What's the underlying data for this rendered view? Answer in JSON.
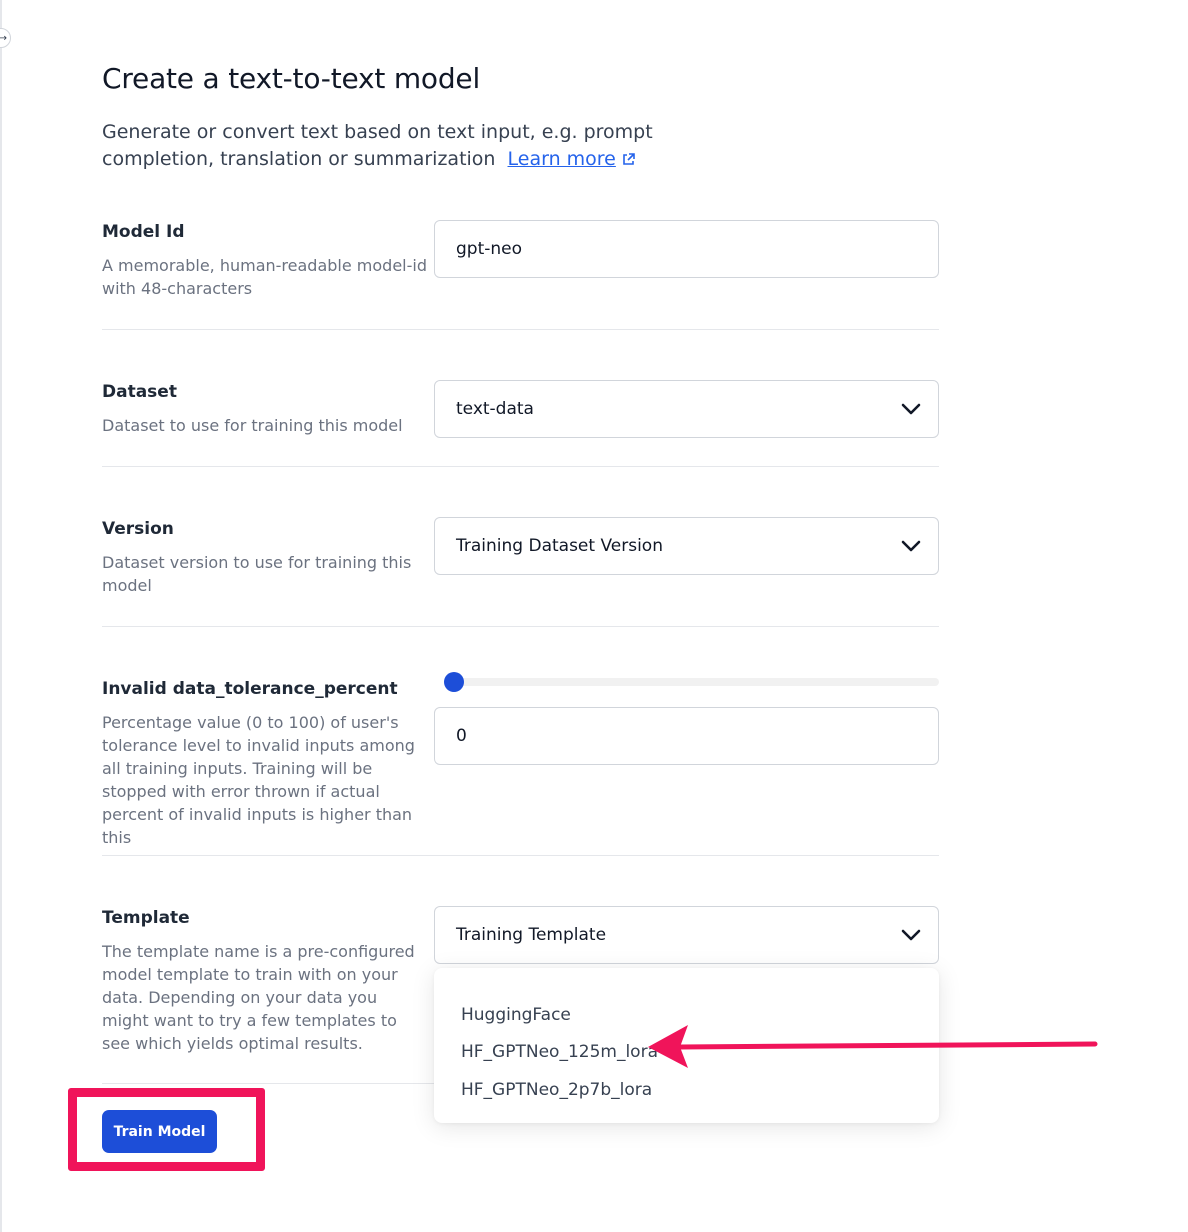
{
  "page": {
    "title": "Create a text-to-text model",
    "subtitle": "Generate or convert text based on text input, e.g. prompt completion, translation or summarization",
    "learn_more": "Learn more"
  },
  "form": {
    "model_id": {
      "label": "Model Id",
      "help": "A memorable, human-readable model-id with 48-characters",
      "value": "gpt-neo"
    },
    "dataset": {
      "label": "Dataset",
      "help": "Dataset to use for training this model",
      "value": "text-data"
    },
    "version": {
      "label": "Version",
      "help": "Dataset version to use for training this model",
      "value": "Training Dataset Version"
    },
    "tolerance": {
      "label": "Invalid data_tolerance_percent",
      "help": "Percentage value (0 to 100) of user's tolerance level to invalid inputs among all training inputs. Training will be stopped with error thrown if actual percent of invalid inputs is higher than this",
      "value": "0",
      "slider_value_percent": 0
    },
    "template": {
      "label": "Template",
      "help": "The template name is a pre-configured model template to train with on your data. Depending on your data you might want to try a few templates to see which yields optimal results.",
      "value": "Training Template",
      "options": [
        "HuggingFace",
        "HF_GPTNeo_125m_lora",
        "HF_GPTNeo_2p7b_lora"
      ]
    }
  },
  "actions": {
    "train_label": "Train Model"
  },
  "annotations": {
    "highlight_color": "#f0145a"
  }
}
